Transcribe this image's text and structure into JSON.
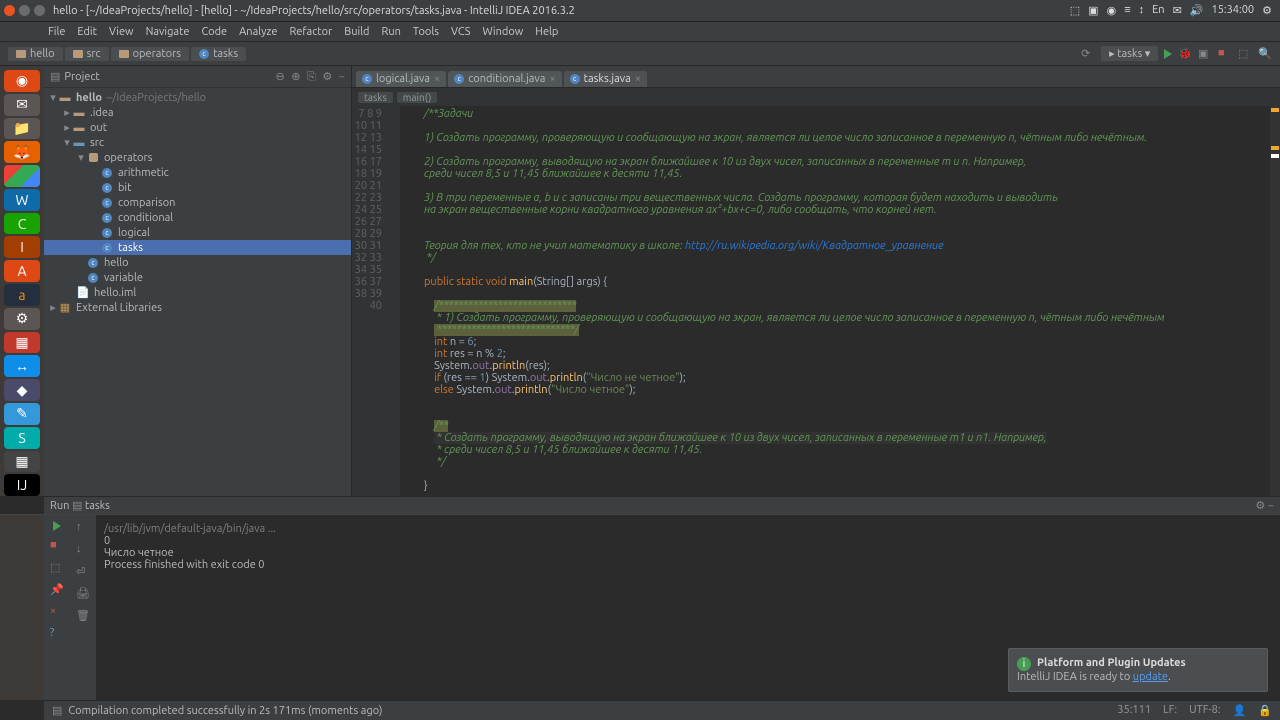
{
  "window": {
    "title": "hello - [~/IdeaProjects/hello] - [hello] - ~/IdeaProjects/hello/src/operators/tasks.java - IntelliJ IDEA 2016.3.2",
    "tray_time": "15:34:00"
  },
  "menu": [
    "File",
    "Edit",
    "View",
    "Navigate",
    "Code",
    "Analyze",
    "Refactor",
    "Build",
    "Run",
    "Tools",
    "VCS",
    "Window",
    "Help"
  ],
  "breadcrumbs": [
    "hello",
    "src",
    "operators",
    "tasks"
  ],
  "run_config": "tasks",
  "project": {
    "header": "Project",
    "root": "hello",
    "root_path": "~/IdeaProjects/hello",
    "nodes": {
      "idea": ".idea",
      "out": "out",
      "src": "src",
      "operators": "operators",
      "arithmetic": "arithmetic",
      "bit": "bit",
      "comparison": "comparison",
      "conditional": "conditional",
      "logical": "logical",
      "tasks": "tasks",
      "hello_cls": "hello",
      "variable": "variable",
      "iml": "hello.iml",
      "ext": "External Libraries"
    }
  },
  "tabs": {
    "logical": "logical.java",
    "conditional": "conditional.java",
    "tasks": "tasks.java"
  },
  "crumb2": {
    "a": "tasks",
    "b": "main()"
  },
  "gutter_start": 7,
  "gutter_end": 40,
  "code": {
    "l7": "/**Задачи",
    "l8": "",
    "l9": "1) Создать программу, проверяющую и сообщающую на экран, является ли целое число записанное в переменную n, чётным либо нечётным.",
    "l10": "",
    "l11": "2) Создать программу, выводящую на экран ближайшее к 10 из двух чисел, записанных в переменные m и n. Например,",
    "l12": "среди чисел 8,5 и 11,45 ближайшее к десяти 11,45.",
    "l13": "",
    "l14": "3) В три переменные a, b и с записаны три вещественных числа. Создать программу, которая будет находить и выводить",
    "l15": "на экран вещественные корни квадратного уравнения ax²+bx+c=0, либо сообщать, что корней нет.",
    "l16": "",
    "l17": "",
    "l18a": "Теория для тех, кто не учил математику в школе: ",
    "l18b": "http://ru.wikipedia.org/wiki/Квадратное_уравнение",
    "l19": " */",
    "stars1": "/****************************",
    "task1": " * 1) Создать программу, проверяющую и сообщающую на экран, является ли целое число записанное в переменную n, чётным либо нечётным",
    "stars2": " ****************************/",
    "str_ne": "\"Число не четное\"",
    "str_ch": "\"Число четное\"",
    "jd2": "/**",
    "jd2a": " * Создать программу, выводящую на экран ближайшее к 10 из двух чисел, записанных в переменные m1 и n1. Например,",
    "jd2b": " * среди чисел 8,5 и 11,45 ближайшее к десяти 11,45.",
    "jd2c": " */"
  },
  "run": {
    "tab": "Run",
    "name": "tasks",
    "out1": "/usr/lib/jvm/default-java/bin/java ...",
    "out2": "0",
    "out3": "Число четное",
    "out4": "",
    "out5": "Process finished with exit code 0"
  },
  "status": {
    "msg": "Compilation completed successfully in 2s 171ms (moments ago)",
    "pos": "35:111",
    "lf": "LF:",
    "enc": "UTF-8:"
  },
  "notif": {
    "title": "Platform and Plugin Updates",
    "body1": "IntelliJ IDEA is ready to ",
    "link": "update",
    "body2": "."
  }
}
